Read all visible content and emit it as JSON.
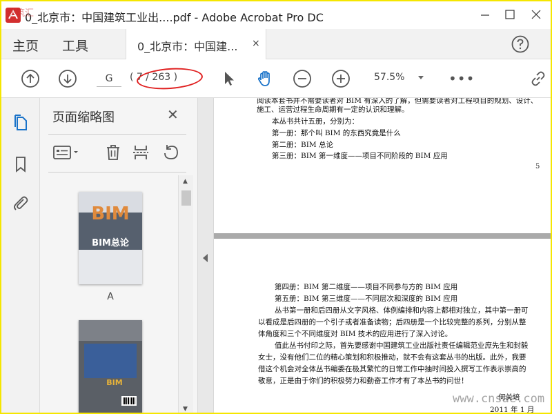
{
  "window": {
    "title": "0_北京市：中国建筑工业出....pdf - Adobe Acrobat Pro DC"
  },
  "tabs": {
    "home": "主页",
    "tools": "工具",
    "document": "0_北京市：中国建...",
    "close_glyph": "×"
  },
  "toolbar": {
    "current_page": "G",
    "page_total": "( 7 / 263 )",
    "zoom": "57.5%",
    "more": "•••"
  },
  "panel": {
    "title": "页面缩略图",
    "close_glyph": "✕",
    "thumbnails": [
      {
        "label": "A",
        "cover_title": "BIM总论",
        "cover_big": "BIM"
      },
      {
        "label": "",
        "cover_title": "BIM"
      }
    ]
  },
  "document": {
    "page_upper": {
      "lines": [
        "阅读本套书并不需要读者对 BIM 有深入的了解，但需要读者对工程项目的规划、设计、",
        "施工、运营过程生命周期有一定的认识和理解。",
        "本丛书共计五册，分别为：",
        "第一册：那个叫 BIM 的东西究竟是什么",
        "第二册：BIM 总论",
        "第三册：BIM 第一维度——项目不同阶段的 BIM 应用"
      ],
      "page_number": "5"
    },
    "page_lower": {
      "lines": [
        "第四册：BIM 第二维度——项目不同参与方的 BIM 应用",
        "第五册：BIM 第三维度——不同层次和深度的 BIM 应用",
        "丛书第一册和后四册从文字风格、体例编排和内容上都相对独立，其中第一册可",
        "以看成是后四册的一个引子或者准备读物；后四册是一个比较完整的系列，分别从整",
        "体角度和三个不同维度对 BIM 技术的应用进行了深入讨论。",
        "值此丛书付印之际，首先要感谢中国建筑工业出版社责任编辑范业庶先生和封毅",
        "女士，没有他们二位的精心策划和积极推动，就不会有这套丛书的出版。此外，我要",
        "借这个机会对全体丛书编委在极其繁忙的日常工作中抽时间投入撰写工作表示崇高的",
        "敬意，正是由于你们的积极努力和勤奋工作才有了本丛书的问世！",
        "何关培",
        "2011 年 1 月"
      ]
    }
  },
  "watermark": {
    "site": "www.cnsae.com",
    "corner": "建筑汇"
  },
  "colors": {
    "accent_blue": "#1a73c9",
    "annotation_red": "#e02020",
    "frame_yellow": "#f5e600"
  }
}
